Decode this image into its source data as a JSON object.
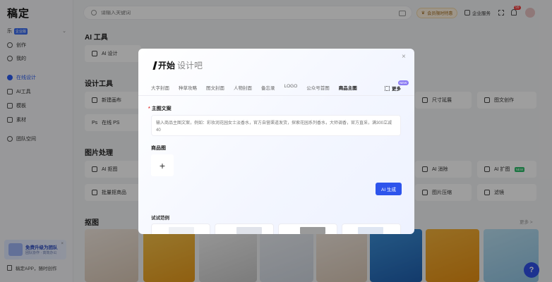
{
  "app": {
    "logo": "稿定"
  },
  "sidebar": {
    "team": {
      "icon_text": "乐",
      "badge": "企业版",
      "label": ""
    },
    "items": [
      {
        "label": "创作",
        "icon": "user-icon"
      },
      {
        "label": "我的",
        "icon": "person-icon"
      },
      {
        "label": "在线设计",
        "icon": "design-icon",
        "active": true
      },
      {
        "label": "AI工具",
        "icon": "ai-icon"
      },
      {
        "label": "模板",
        "icon": "template-icon"
      },
      {
        "label": "素材",
        "icon": "material-icon"
      },
      {
        "label": "团队空间",
        "icon": "team-icon"
      }
    ],
    "upgrade": {
      "title": "免费升级为团队",
      "subtitle": "团队协作 · 高效办公"
    },
    "download": "稿定APP，随时创作"
  },
  "topbar": {
    "search_placeholder": "请输入关键词",
    "vip_label": "会员限时特惠",
    "business_label": "企业服务",
    "notification_count": "99"
  },
  "main": {
    "sections": [
      {
        "title": "AI 工具"
      },
      {
        "title": "设计工具"
      },
      {
        "title": "图片处理"
      },
      {
        "title": "抠图"
      }
    ],
    "tools": {
      "ai_design": "AI 设计",
      "new_canvas": "新建画布",
      "online_ps": "在线 PS",
      "ai_cutout": "AI 抠图",
      "batch_product": "批量抠商品",
      "size_change": "尺寸延展",
      "image_create": "图文创作",
      "ai_erase": "AI 消除",
      "ai_expand": "AI 扩图",
      "ai_expand_badge": "NEW",
      "image_compress": "图片压缩",
      "filter": "滤镜"
    },
    "more_label": "更多 >"
  },
  "modal": {
    "brand_bold": "开始",
    "brand_light": "设计吧",
    "close": "×",
    "tabs": [
      "大字封面",
      "种草攻略",
      "图文封面",
      "人物封面",
      "备忘录",
      "LOGO",
      "公众号首图",
      "商品主图"
    ],
    "active_tab_index": 7,
    "more_label": "更多",
    "more_badge": "NEW",
    "field_main_text": {
      "required_mark": "*",
      "label": "主图文案",
      "placeholder": "输入商品主图文案，例如：彩妆润花园女士淡香水，官方自营渠道发货，探索花园系列香水，大师调香，官方直采，满300立减40"
    },
    "field_image": {
      "label": "商品图",
      "upload_symbol": "+"
    },
    "generate_button": "AI 生成",
    "examples_label": "试试范例"
  },
  "colors": {
    "accent": "#2d54ec",
    "overlay": "rgba(0,0,0,0.38)",
    "required": "#e53b3b"
  }
}
